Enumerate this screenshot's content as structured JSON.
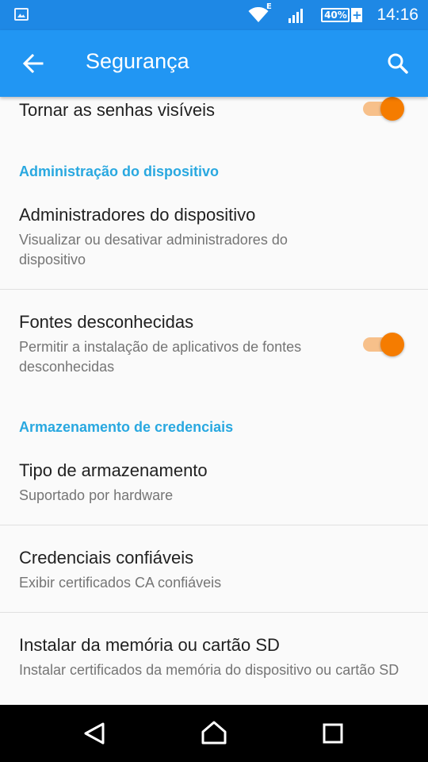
{
  "status_bar": {
    "network_type": "E",
    "battery_level": "40%",
    "battery_charging_symbol": "+",
    "time": "14:16"
  },
  "app_bar": {
    "title": "Segurança",
    "back_icon": "arrow-back-icon",
    "search_icon": "search-icon"
  },
  "settings": {
    "show_passwords": {
      "title": "Tornar as senhas visíveis",
      "enabled": true
    },
    "device_admin_section": "Administração do dispositivo",
    "device_admins": {
      "title": "Administradores do dispositivo",
      "summary": "Visualizar ou desativar administradores do dispositivo"
    },
    "unknown_sources": {
      "title": "Fontes desconhecidas",
      "summary": "Permitir a instalação de aplicativos de fontes desconhecidas",
      "enabled": true
    },
    "credential_storage_section": "Armazenamento de credenciais",
    "storage_type": {
      "title": "Tipo de armazenamento",
      "summary": "Suportado por hardware"
    },
    "trusted_credentials": {
      "title": "Credenciais confiáveis",
      "summary": "Exibir certificados CA confiáveis"
    },
    "install_from_sd": {
      "title": "Instalar da memória ou cartão SD",
      "summary": "Instalar certificados da memória do dispositivo ou cartão SD"
    }
  },
  "colors": {
    "status_bar": "#1e88e5",
    "app_bar": "#2196f3",
    "section_header": "#29a8e0",
    "toggle_on": "#f57c00"
  }
}
